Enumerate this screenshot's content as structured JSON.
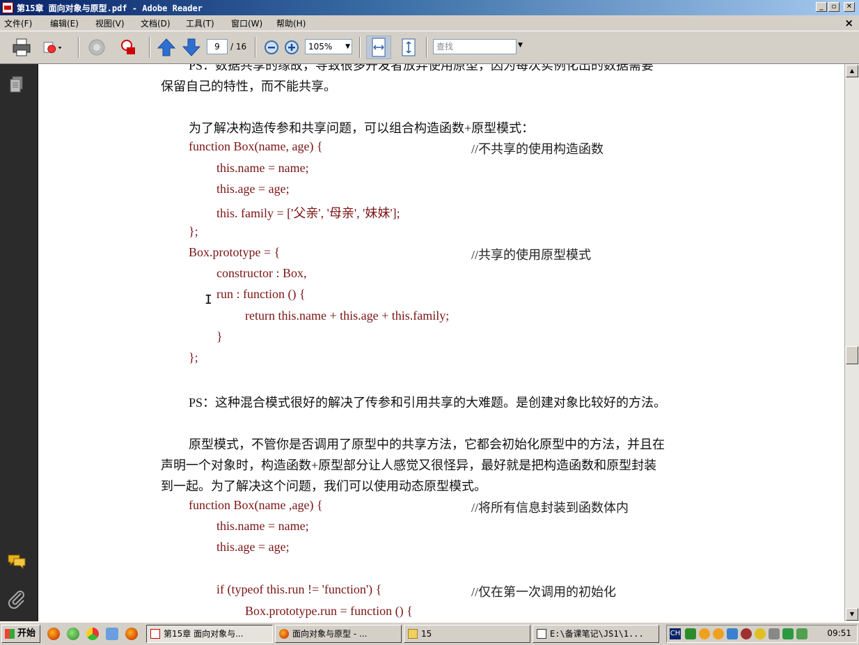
{
  "window": {
    "title": "第15章 面向对象与原型.pdf - Adobe Reader",
    "minimize": "_",
    "restore": "▫",
    "close": "✕"
  },
  "menu": {
    "items": [
      "文件(F)",
      "编辑(E)",
      "视图(V)",
      "文档(D)",
      "工具(T)",
      "窗口(W)",
      "帮助(H)"
    ],
    "close": "×"
  },
  "toolbar": {
    "page_current": "9",
    "page_total": "/ 16",
    "zoom": "105%",
    "find_placeholder": "查找"
  },
  "document": {
    "lines": [
      "PS：数据共享的缘故，导致很多开发者放弃使用原型，因为每次实例化出的数据需要",
      "保留自己的特性，而不能共享。",
      "为了解决构造传参和共享问题，可以组合构造函数+原型模式：",
      "function Box(name, age) {",
      "//不共享的使用构造函数",
      "this.name = name;",
      "this.age = age;",
      "this. family = ['父亲', '母亲', '妹妹'];",
      "};",
      "Box.prototype = {",
      "//共享的使用原型模式",
      "constructor : Box,",
      "run : function () {",
      "return this.name + this.age + this.family;",
      "}",
      "};",
      "PS：这种混合模式很好的解决了传参和引用共享的大难题。是创建对象比较好的方法。",
      "原型模式，不管你是否调用了原型中的共享方法，它都会初始化原型中的方法，并且在",
      "声明一个对象时，构造函数+原型部分让人感觉又很怪异，最好就是把构造函数和原型封装",
      "到一起。为了解决这个问题，我们可以使用动态原型模式。",
      "function Box(name ,age) {",
      "//将所有信息封装到函数体内",
      "this.name = name;",
      "this.age = age;",
      "if (typeof this.run != 'function') {",
      "//仅在第一次调用的初始化",
      "Box.prototype.run = function () {"
    ]
  },
  "taskbar": {
    "start": "开始",
    "tasks": [
      "第15章 面向对象与...",
      "面向对象与原型 - ...",
      "15",
      "E:\\备课笔记\\JS1\\1..."
    ],
    "ime": "CH",
    "clock": "09:51"
  }
}
